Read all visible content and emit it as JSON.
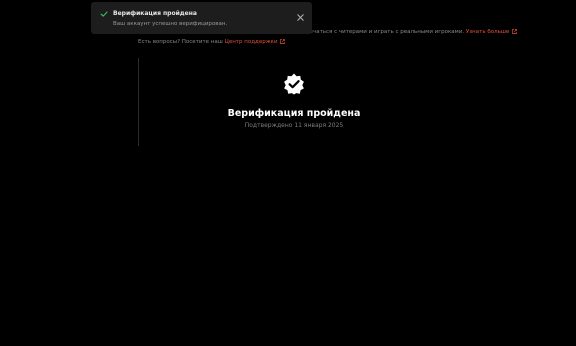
{
  "toast": {
    "title": "Верификация пройдена",
    "message": "Ваш аккаунт успешно верифицирован.",
    "check_icon": "check-icon",
    "close_icon": "close-icon",
    "accent": "#3fbf5a"
  },
  "intro": {
    "line1_text": "Присоединяйтесь к нам на серверах FACEIT, чтобы не встречаться с читерами и играть с реальными игроками.",
    "line1_link": "Узнать больше",
    "line2_text": "Есть вопросы? Посетите наш",
    "line2_link": "Центр поддержки",
    "link_color": "#e5533d"
  },
  "verification": {
    "badge_icon": "verified-badge-icon",
    "title": "Верификация пройдена",
    "subtitle": "Подтверждено 11 января 2025"
  }
}
